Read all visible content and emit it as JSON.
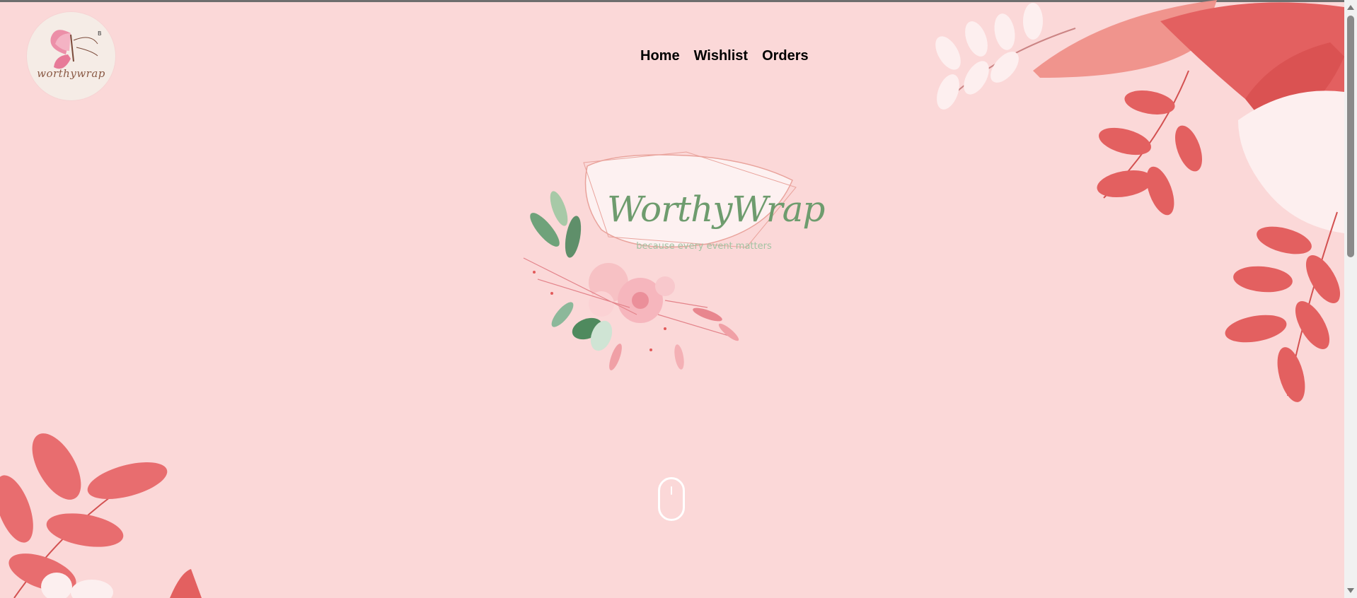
{
  "logo": {
    "text": "worthywrap",
    "icon": "butterfly-icon"
  },
  "nav": {
    "items": [
      {
        "label": "Home"
      },
      {
        "label": "Wishlist"
      },
      {
        "label": "Orders"
      }
    ]
  },
  "hero": {
    "title": "WorthyWrap",
    "tagline": "because every event matters"
  },
  "scroll_indicator": {
    "icon": "mouse-scroll-icon"
  },
  "colors": {
    "background": "#fbd8d8",
    "leaf_coral": "#e8686a",
    "leaf_red": "#df5252",
    "leaf_white": "#fdf0f0",
    "brand_green": "#6e9c6e"
  }
}
